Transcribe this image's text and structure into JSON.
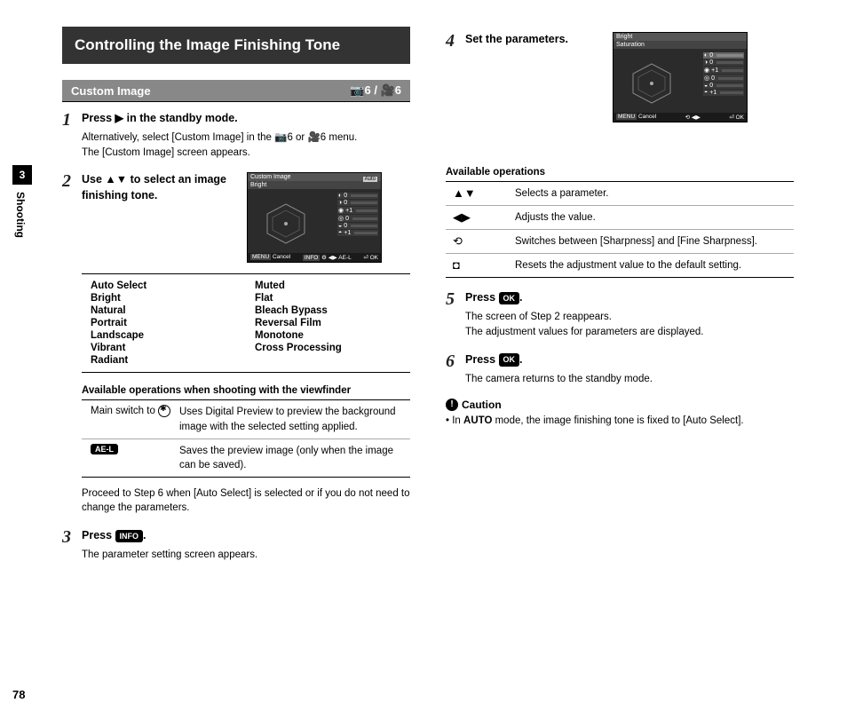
{
  "header": {
    "title": "Controlling the Image Finishing Tone"
  },
  "subheader": {
    "label": "Custom Image",
    "menu_ref": "6 / ",
    "menu_ref2": "6"
  },
  "side": {
    "chapter": "3",
    "label": "Shooting",
    "page": "78"
  },
  "step1": {
    "num": "1",
    "title_a": "Press ",
    "title_b": " in the standby mode.",
    "body1": "Alternatively, select [Custom Image] in the ",
    "body2": "6 or ",
    "body3": "6 menu.",
    "body4": "The [Custom Image] screen appears."
  },
  "step2": {
    "num": "2",
    "title": "Use ▲▼ to select an image finishing tone."
  },
  "lcd1": {
    "line1": "Custom Image",
    "line2": "Bright",
    "auto": "Auto",
    "cancel": "Cancel",
    "info": "INFO",
    "ok": "OK",
    "params": [
      "0",
      "0",
      "+1",
      "0",
      "0",
      "+1"
    ]
  },
  "tones_left": [
    "Auto Select",
    "Bright",
    "Natural",
    "Portrait",
    "Landscape",
    "Vibrant",
    "Radiant"
  ],
  "tones_right": [
    "Muted",
    "Flat",
    "Bleach Bypass",
    "Reversal Film",
    "Monotone",
    "Cross Processing"
  ],
  "ops_heading": "Available operations when shooting with the viewfinder",
  "ops1": [
    {
      "key": "Main switch to ",
      "desc": "Uses Digital Preview to preview the background image with the selected setting applied."
    },
    {
      "key": "",
      "desc": "Saves the preview image (only when the image can be saved)."
    }
  ],
  "ops1_key2_badge": "AE-L",
  "step2_note": "Proceed to Step 6 when [Auto Select] is selected or if you do not need to change the parameters.",
  "step3": {
    "num": "3",
    "title_a": "Press ",
    "title_b": ".",
    "body": "The parameter setting screen appears.",
    "badge": "INFO"
  },
  "step4": {
    "num": "4",
    "title": "Set the parameters."
  },
  "lcd2": {
    "line1": "Bright",
    "line2": "Saturation",
    "cancel": "Cancel",
    "ok": "OK",
    "params": [
      "0",
      "0",
      "+1",
      "0",
      "0",
      "+1"
    ]
  },
  "ops2_heading": "Available operations",
  "ops2": [
    {
      "key": "▲▼",
      "desc": "Selects a parameter."
    },
    {
      "key": "◀▶",
      "desc": "Adjusts the value."
    },
    {
      "key": "⟲",
      "desc": "Switches between [Sharpness] and [Fine Sharpness]."
    },
    {
      "key": "◘",
      "desc": "Resets the adjustment value to the default setting."
    }
  ],
  "step5": {
    "num": "5",
    "title_a": "Press ",
    "title_b": ".",
    "badge": "OK",
    "body1": "The screen of Step 2 reappears.",
    "body2": "The adjustment values for parameters are displayed."
  },
  "step6": {
    "num": "6",
    "title_a": "Press ",
    "title_b": ".",
    "badge": "OK",
    "body": "The camera returns to the standby mode."
  },
  "caution": {
    "head": "Caution",
    "bullet": "•",
    "body_a": "In ",
    "body_mode": "AUTO",
    "body_b": " mode, the image finishing tone is fixed to [Auto Select]."
  }
}
